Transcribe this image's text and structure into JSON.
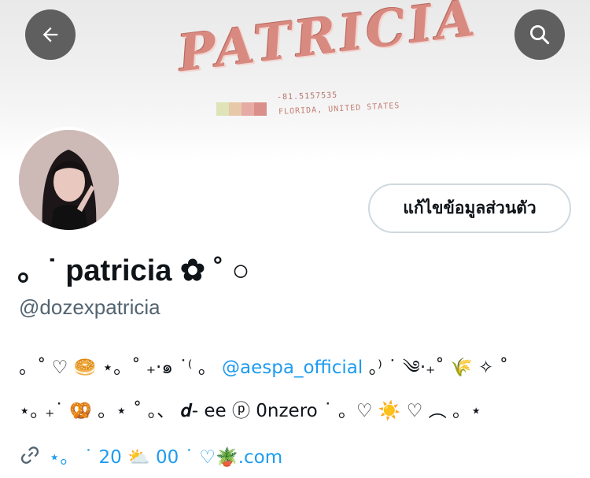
{
  "banner": {
    "title": "PATRICIA",
    "coordinates": "-81.5157535",
    "location": "FLORIDA, UNITED STATES",
    "palette": [
      "#dfe3b8",
      "#e7c9a9",
      "#e7aba5",
      "#db8f8b"
    ]
  },
  "header": {
    "back_icon": "arrow-left-icon",
    "search_icon": "search-icon"
  },
  "profile": {
    "edit_button_label": "แก้ไขข้อมูลส่วนตัว",
    "display_name": "。˙ patricia ✿ ˚ ○",
    "handle": "@dozexpatricia"
  },
  "bio": {
    "line1_prefix": "。˚ ♡ 🥯 ⋆。˚ ₊‧๑ ˙⁽ 。",
    "line1_mention": "@aespa_official",
    "line1_suffix": " 。⁾ ˙ ༄‧₊˚ 🌾 ✧ ˚",
    "line2": "⋆｡ ₊˙ 🥨 。⋆ ˚ 。、 𝒅- ee ⓟ 0nzero ˙ 。♡ ☀️ ♡ ︵ 。⋆"
  },
  "link": {
    "icon": "link-icon",
    "text": "⋆。 ˙ 20 ⛅ 00 ˙ ♡🪴.com"
  }
}
